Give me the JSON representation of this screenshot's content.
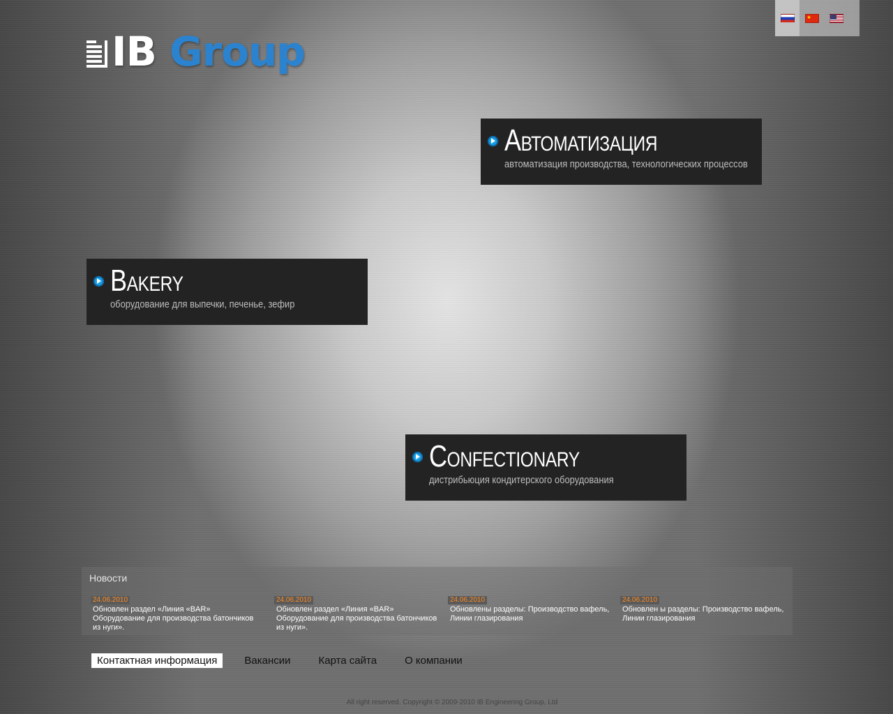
{
  "logo": {
    "ib": "IB",
    "group": "Group",
    "accent_color": "#2b83cf"
  },
  "languages": [
    {
      "code": "ru",
      "icon": "russian-flag-icon",
      "active": true
    },
    {
      "code": "cn",
      "icon": "chinese-flag-icon",
      "active": false
    },
    {
      "code": "us",
      "icon": "us-flag-icon",
      "active": false
    }
  ],
  "panels": {
    "automation": {
      "title_cap": "А",
      "title_rest": "втоматизация",
      "subtitle": "автоматизация производства, технологических процессов"
    },
    "bakery": {
      "title_cap": "B",
      "title_rest": "akery",
      "subtitle": "оборудование для выпечки, печенье, зефир"
    },
    "confectionary": {
      "title_cap": "C",
      "title_rest": "onfectionary",
      "subtitle": "дистрибьюция кондитерского оборудования"
    }
  },
  "news": {
    "title": "Новости",
    "items": [
      {
        "date": "24.06.2010",
        "text": "Обновлен раздел «Линия «BAR» Оборудование для производства батончиков из нуги»."
      },
      {
        "date": "24.06.2010",
        "text": "Обновлен раздел «Линия «BAR» Оборудование для производства батончиков из нуги»."
      },
      {
        "date": "24.06.2010",
        "text": "Обновлены разделы: Производство вафель, Линии глазирования"
      },
      {
        "date": "24.06.2010",
        "text": "Обновлен ы разделы: Производство вафель, Линии глазирования"
      }
    ],
    "date_color": "#ff8a1f"
  },
  "footer_nav": {
    "contacts": "Контактная информация",
    "vacancies": "Вакансии",
    "sitemap": "Карта сайта",
    "about": "О компании"
  },
  "copyright": "All right reserved. Copyright © 2009-2010 IB Engineering Group, Ltd"
}
